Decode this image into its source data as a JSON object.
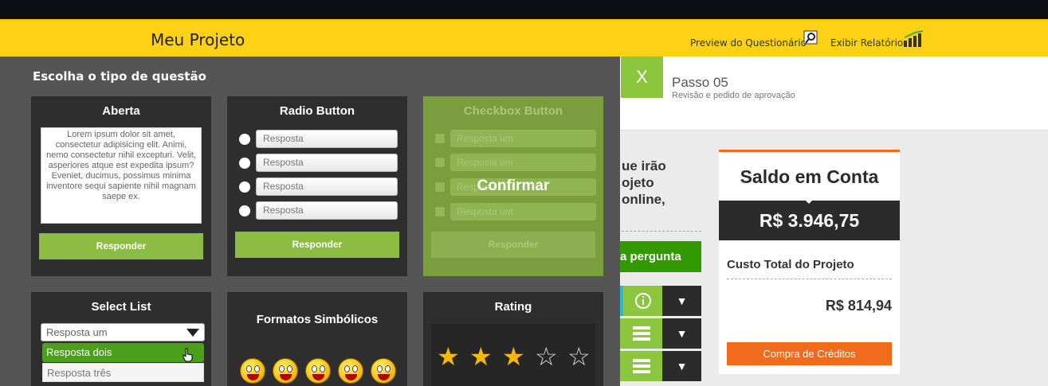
{
  "header": {
    "app_title": "Meu Projeto",
    "preview_label": "Preview do Questionário",
    "report_label": "Exibir Relatório",
    "preview_icon": "magnifier-icon",
    "report_icon": "bar-chart-icon",
    "accent_color": "#fcd116"
  },
  "step": {
    "close_label": "X",
    "title": "Passo 05",
    "subtitle": "Revisão e pedido de aprovação"
  },
  "background": {
    "text_lines": [
      "ue irão",
      "ojeto",
      "online,"
    ],
    "add_question_label": "a pergunta"
  },
  "account": {
    "title": "Saldo em Conta",
    "balance": "R$ 3.946,75",
    "cost_label": "Custo Total do Projeto",
    "cost_value": "R$  814,94",
    "buy_label": "Compra de Créditos"
  },
  "panel": {
    "title": "Escolha o tipo de questão",
    "cards": {
      "aberta": {
        "title": "Aberta",
        "text": "Lorem ipsum dolor sit amet, consectetur adipisicing elit. Animi, nemo consectetur nihil excepturi. Velit, asperiores atque est expedita ipsum? Eveniet, ducimus, possimus minima inventore sequi sapiente nihil magnam saepe ex.",
        "button": "Responder"
      },
      "radio": {
        "title": "Radio Button",
        "options": [
          "Resposta",
          "Resposta",
          "Resposta",
          "Resposta"
        ],
        "button": "Responder"
      },
      "checkbox": {
        "title": "Checkbox Button",
        "options": [
          "Resposta um",
          "Resposta um",
          "Resposta um",
          "Resposta um"
        ],
        "confirm": "Confirmar",
        "button": "Responder"
      },
      "select": {
        "title": "Select List",
        "selected": "Resposta um",
        "options": [
          "Resposta dois",
          "Resposta três"
        ]
      },
      "symbolic": {
        "title": "Formatos Simbólicos"
      },
      "rating": {
        "title": "Rating",
        "value": 3,
        "max": 5
      }
    }
  }
}
